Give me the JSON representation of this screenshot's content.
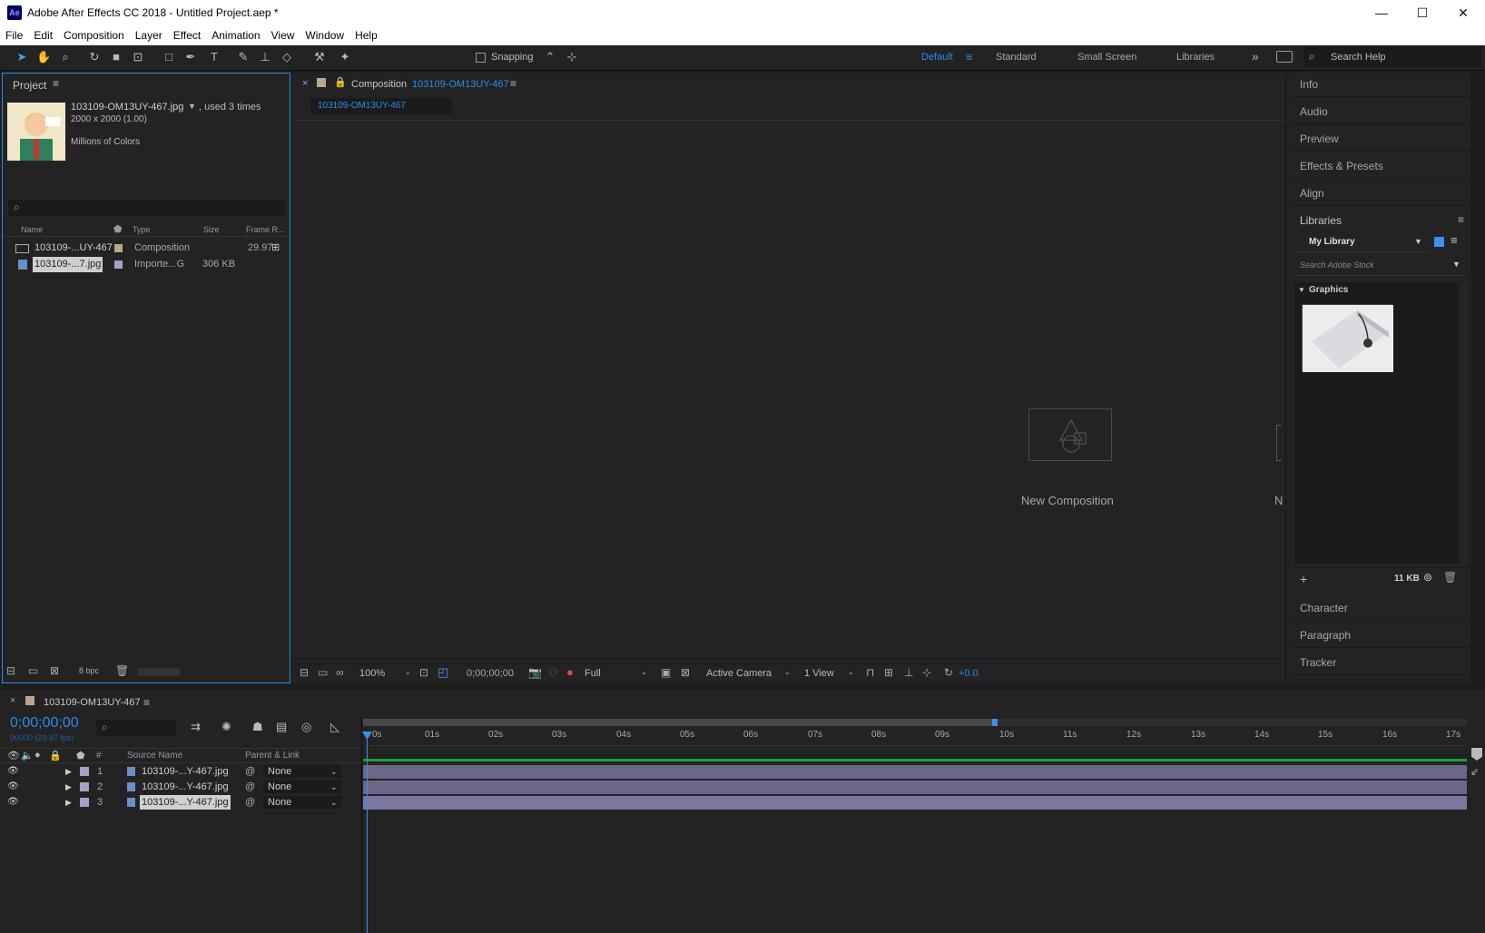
{
  "app": {
    "badge": "Ae",
    "title": "Adobe After Effects CC 2018 - Untitled Project.aep *"
  },
  "window_controls": {
    "min": "—",
    "max": "☐",
    "close": "✕"
  },
  "menu": [
    "File",
    "Edit",
    "Composition",
    "Layer",
    "Effect",
    "Animation",
    "View",
    "Window",
    "Help"
  ],
  "toolbar": {
    "snapping": "Snapping",
    "workspaces": [
      "Default",
      "Standard",
      "Small Screen",
      "Libraries"
    ],
    "more": "»",
    "search_placeholder": "Search Help"
  },
  "project": {
    "tab": "Project",
    "filename": "103109-OM13UY-467.jpg",
    "used": ", used 3 times",
    "dims": "2000 x 2000 (1.00)",
    "colors": "Millions of Colors",
    "columns": [
      "Name",
      "Type",
      "Size",
      "Frame R..."
    ],
    "items": [
      {
        "name": "103109-...UY-467",
        "type": "Composition",
        "size": "",
        "fps": "29.97"
      },
      {
        "name": "103109-...7.jpg",
        "type": "Importe...G",
        "size": "306 KB",
        "fps": ""
      }
    ],
    "bpc": "8 bpc"
  },
  "composition": {
    "tab_prefix": "Composition",
    "tab_name": "103109-OM13UY-467",
    "subtab": "103109-OM13UY-467",
    "new_comp": "New Composition",
    "edge_letter": "N",
    "zoom": "100%",
    "timecode": "0;00;00;00",
    "resolution": "Full",
    "camera": "Active Camera",
    "view": "1 View",
    "exposure": "+0.0"
  },
  "right_panel": {
    "items_top": [
      "Info",
      "Audio",
      "Preview",
      "Effects & Presets",
      "Align"
    ],
    "libraries": {
      "title": "Libraries",
      "library": "My Library",
      "search_placeholder": "Search Adobe Stock",
      "section": "Graphics",
      "size": "11 KB"
    },
    "items_bottom": [
      "Character",
      "Paragraph",
      "Tracker"
    ]
  },
  "timeline": {
    "tab": "103109-OM13UY-467",
    "timecode": "0;00;00;00",
    "fps_line": "00000 (29.97 fps)",
    "col_num": "#",
    "col_source": "Source Name",
    "col_parent": "Parent & Link",
    "ticks": [
      "0s",
      "01s",
      "02s",
      "03s",
      "04s",
      "05s",
      "06s",
      "07s",
      "08s",
      "09s",
      "10s",
      "11s",
      "12s",
      "13s",
      "14s",
      "15s",
      "16s",
      "17s"
    ],
    "layers": [
      {
        "num": "1",
        "name": "103109-...Y-467.jpg",
        "parent": "None"
      },
      {
        "num": "2",
        "name": "103109-...Y-467.jpg",
        "parent": "None"
      },
      {
        "num": "3",
        "name": "103109-...Y-467.jpg",
        "parent": "None"
      }
    ]
  },
  "colors": {
    "accent": "#2d8ceb",
    "track": "#6a6789",
    "work_bar": "#1f9d3a"
  }
}
